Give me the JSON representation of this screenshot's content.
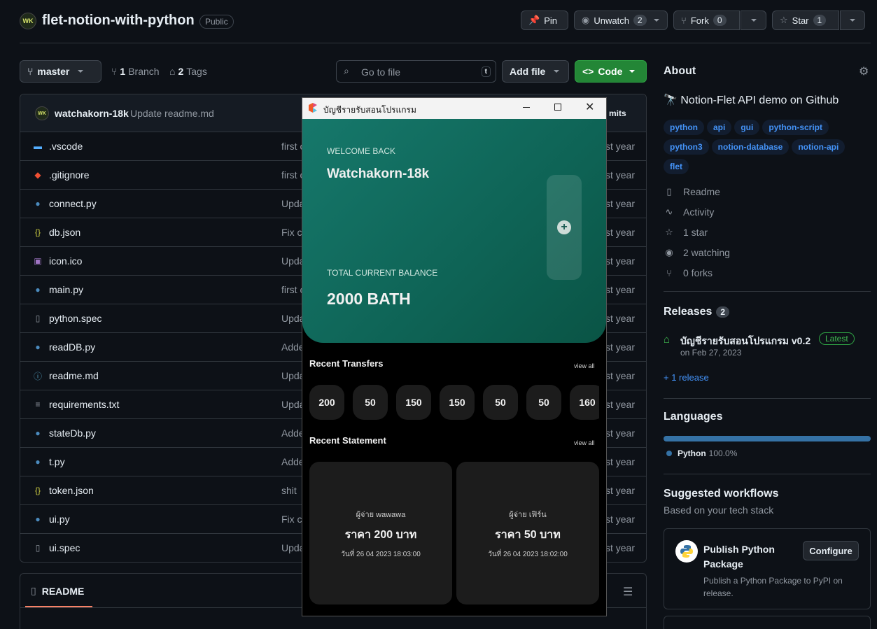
{
  "repo": {
    "owner_initials": "WK",
    "name": "flet-notion-with-python",
    "visibility": "Public",
    "actions": {
      "pin": "Pin",
      "unwatch": "Unwatch",
      "unwatch_count": "2",
      "fork": "Fork",
      "fork_count": "0",
      "star": "Star",
      "star_count": "1"
    }
  },
  "toolbar": {
    "branch": "master",
    "branches_count": "1",
    "branches_label": "Branch",
    "tags_count": "2",
    "tags_label": "Tags",
    "search_placeholder": "Go to file",
    "search_key": "t",
    "add_file": "Add file",
    "code": "Code"
  },
  "commit": {
    "author_initials": "WK",
    "author": "watchakorn-18k",
    "message": "Update readme.md",
    "commits_label": "mits"
  },
  "files": [
    {
      "name": ".vscode",
      "icon": "folder-icon",
      "msg": "first c",
      "date": "st year"
    },
    {
      "name": ".gitignore",
      "icon": "git-icon",
      "msg": "first c",
      "date": "st year"
    },
    {
      "name": "connect.py",
      "icon": "python-icon",
      "msg": "Upda",
      "date": "st year"
    },
    {
      "name": "db.json",
      "icon": "json-icon",
      "msg": "Fix co",
      "date": "st year"
    },
    {
      "name": "icon.ico",
      "icon": "image-file-icon",
      "msg": "Upda",
      "date": "st year"
    },
    {
      "name": "main.py",
      "icon": "python-icon",
      "msg": "first c",
      "date": "st year"
    },
    {
      "name": "python.spec",
      "icon": "file-icon",
      "msg": "Upda",
      "date": "st year"
    },
    {
      "name": "readDB.py",
      "icon": "python-icon",
      "msg": "Adde",
      "date": "st year"
    },
    {
      "name": "readme.md",
      "icon": "info-icon",
      "msg": "Upda",
      "date": "st year"
    },
    {
      "name": "requirements.txt",
      "icon": "text-file-icon",
      "msg": "Upda",
      "date": "st year"
    },
    {
      "name": "stateDb.py",
      "icon": "python-icon",
      "msg": "Adde",
      "date": "st year"
    },
    {
      "name": "t.py",
      "icon": "python-icon",
      "msg": "Adde",
      "date": "st year"
    },
    {
      "name": "token.json",
      "icon": "json-icon",
      "msg": "shit",
      "date": "st year"
    },
    {
      "name": "ui.py",
      "icon": "python-icon",
      "msg": "Fix co",
      "date": "st year"
    },
    {
      "name": "ui.spec",
      "icon": "file-icon",
      "msg": "Upda",
      "date": "st year"
    }
  ],
  "readme_tab": "README",
  "about": {
    "title": "About",
    "description": "🔭 Notion-Flet API demo on Github",
    "topics": [
      "python",
      "api",
      "gui",
      "python-script",
      "python3",
      "notion-database",
      "notion-api",
      "flet"
    ],
    "links": [
      {
        "icon": "book-icon",
        "label": "Readme"
      },
      {
        "icon": "pulse-icon",
        "label": "Activity"
      },
      {
        "icon": "star-icon",
        "label": "1 star"
      },
      {
        "icon": "eye-icon",
        "label": "2 watching"
      },
      {
        "icon": "fork-icon",
        "label": "0 forks"
      }
    ]
  },
  "releases": {
    "title": "Releases",
    "count": "2",
    "latest_name": "บัญชีรายรับสอนโปรแกรม v0.2",
    "latest_badge": "Latest",
    "latest_date": "on Feb 27, 2023",
    "more": "+ 1 release"
  },
  "languages": {
    "title": "Languages",
    "name": "Python",
    "percent": "100.0%",
    "share": 1.0,
    "color": "#3572a5"
  },
  "workflows": {
    "title": "Suggested workflows",
    "subtitle": "Based on your tech stack",
    "card_title": "Publish Python Package",
    "card_desc": "Publish a Python Package to PyPI on release.",
    "configure": "Configure"
  },
  "app": {
    "window_title": "บัญชีรายรับสอนโปรแกรม",
    "welcome": "WELCOME BACK",
    "user": "Watchakorn-18k",
    "balance_label": "TOTAL CURRENT BALANCE",
    "balance": "2000 BATH",
    "add_symbol": "+",
    "transfers_title": "Recent Transfers",
    "view_all": "view all",
    "transfers": [
      "200",
      "50",
      "150",
      "150",
      "50",
      "50",
      "160"
    ],
    "statement_title": "Recent Statement",
    "statements": [
      {
        "payer": "ผู้จ่าย wawawa",
        "amount": "ราคา 200 บาท",
        "date": "วันที่ 26 04 2023 18:03:00"
      },
      {
        "payer": "ผู้จ่าย เฟิร์น",
        "amount": "ราคา 50 บาท",
        "date": "วันที่ 26 04 2023 18:02:00"
      }
    ],
    "accent": "#137060"
  }
}
